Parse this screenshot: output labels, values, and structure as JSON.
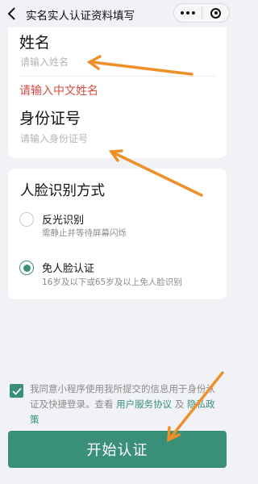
{
  "header": {
    "title": "实名实人认证资料填写",
    "back_icon": "chevron-left-icon",
    "more_icon": "more-dots-icon",
    "close_icon": "target-close-icon"
  },
  "form": {
    "name_label": "姓名",
    "name_placeholder": "请输入姓名",
    "name_error": "请输入中文姓名",
    "id_label": "身份证号",
    "id_placeholder": "请输入身份证号"
  },
  "face": {
    "title": "人脸识别方式",
    "options": [
      {
        "label": "反光识别",
        "desc": "需静止并等待屏幕闪烁",
        "selected": false
      },
      {
        "label": "免人脸认证",
        "desc": "16岁及以下或65岁及以上免人脸识别",
        "selected": true
      }
    ]
  },
  "agreement": {
    "checked": true,
    "text": "我同意小程序使用我所提交的信息用于身份认证及快捷登录。查看",
    "link1": "用户服务协议",
    "and": "及",
    "link2": "隐私政策"
  },
  "submit_label": "开始认证",
  "colors": {
    "accent": "#3a8f78",
    "error": "#d94b3f",
    "annotation_arrow": "#ee8f2a",
    "background": "#f1f2f6"
  }
}
